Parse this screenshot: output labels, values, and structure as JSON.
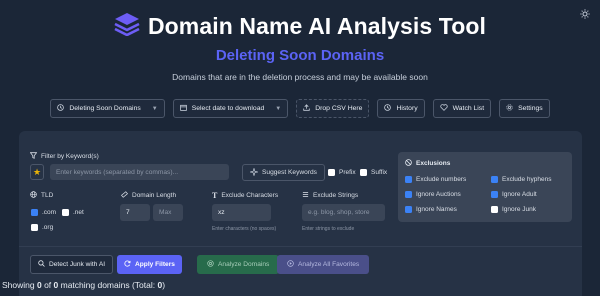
{
  "header": {
    "title": "Domain Name AI Analysis Tool",
    "subtitle": "Deleting Soon Domains",
    "description": "Domains that are in the deletion process and may be available soon"
  },
  "toolbar": {
    "category_select": "Deleting Soon Domains",
    "date_select": "Select date to download",
    "drop_csv": "Drop CSV Here",
    "history": "History",
    "watch_list": "Watch List",
    "settings": "Settings"
  },
  "filters": {
    "keyword_label": "Filter by Keyword(s)",
    "keyword_placeholder": "Enter keywords (separated by commas)...",
    "suggest_keywords": "Suggest Keywords",
    "prefix": "Prefix",
    "suffix": "Suffix",
    "tld_label": "TLD",
    "tld_options": [
      {
        "label": ".com",
        "checked": true
      },
      {
        "label": ".net",
        "checked": false
      },
      {
        "label": ".org",
        "checked": false
      }
    ],
    "length_label": "Domain Length",
    "length_min": "7",
    "length_max_placeholder": "Max",
    "exclude_chars_label": "Exclude Characters",
    "exclude_chars_value": "xz",
    "exclude_chars_hint": "Enter characters (no spaces)",
    "exclude_strings_label": "Exclude Strings",
    "exclude_strings_placeholder": "e.g. blog, shop, store",
    "exclude_strings_hint": "Enter strings to exclude"
  },
  "exclusions": {
    "title": "Exclusions",
    "items": [
      {
        "label": "Exclude numbers",
        "checked": true
      },
      {
        "label": "Exclude hyphens",
        "checked": true
      },
      {
        "label": "Ignore Auctions",
        "checked": true
      },
      {
        "label": "Ignore Adult",
        "checked": true
      },
      {
        "label": "Ignore Names",
        "checked": true
      },
      {
        "label": "Ignore Junk",
        "checked": false
      }
    ]
  },
  "actions": {
    "detect_junk": "Detect Junk with AI",
    "apply_filters": "Apply Filters",
    "analyze_domains": "Analyze Domains",
    "analyze_favorites": "Analyze All Favorites"
  },
  "status": {
    "prefix": "Showing ",
    "shown": "0",
    "of": " of ",
    "matching": "0",
    "suffix": " matching domains (Total: ",
    "total": "0",
    "close": ")"
  },
  "colors": {
    "background": "#1b2637",
    "card": "#263245",
    "accent": "#5b63f5",
    "checkbox": "#3b82f6",
    "analyze_green": "#276b4b"
  }
}
